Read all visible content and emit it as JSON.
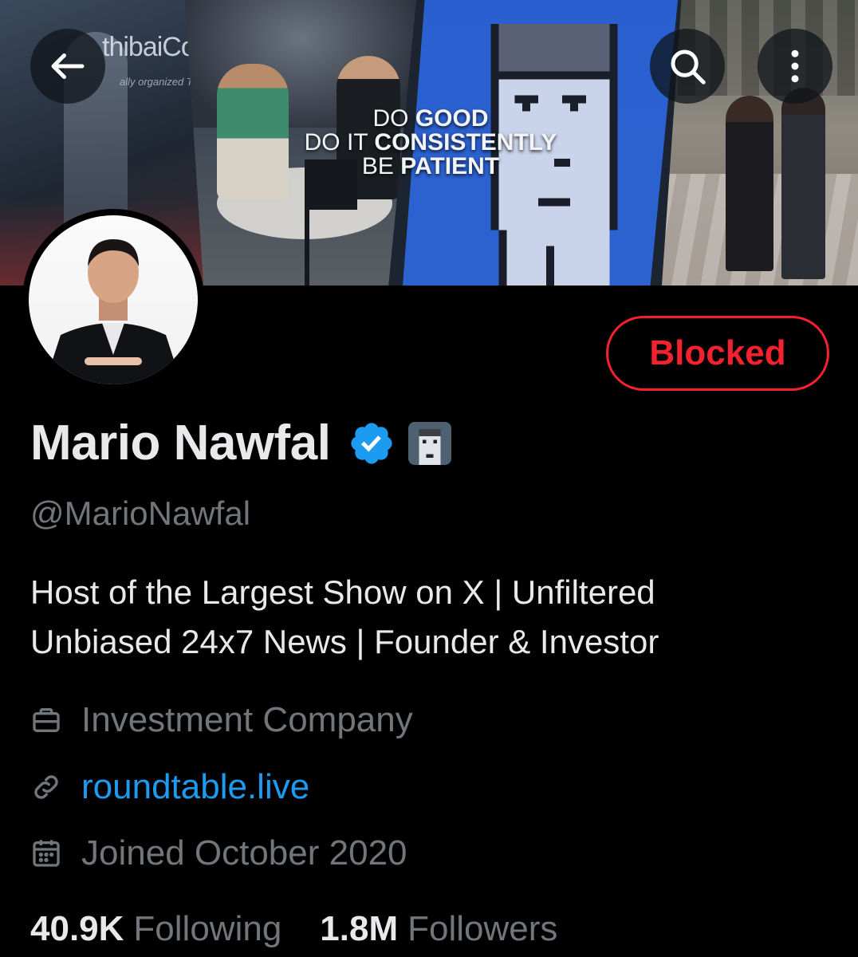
{
  "banner": {
    "sign_text": "thibaiColl",
    "sign_subtext": "ally organized TED e",
    "quote": {
      "line1_light": "DO",
      "line1_bold": "GOOD",
      "line2_light": "DO IT",
      "line2_bold": "CONSISTENTLY",
      "line3_light": "BE",
      "line3_bold": "PATIENT"
    }
  },
  "header": {
    "back_icon": "arrow-left-icon",
    "search_icon": "search-icon",
    "more_icon": "more-vertical-icon"
  },
  "profile": {
    "display_name": "Mario Nawfal",
    "handle": "@MarioNawfal",
    "bio_line1": "Host of the Largest Show on X | Unfiltered",
    "bio_line2": "Unbiased 24x7 News | Founder & Investor",
    "category": "Investment Company",
    "website": "roundtable.live",
    "joined": "Joined October 2020",
    "action_button": "Blocked"
  },
  "stats": {
    "following_count": "40.9K",
    "following_label": "Following",
    "followers_count": "1.8M",
    "followers_label": "Followers"
  },
  "colors": {
    "background": "#000000",
    "text_primary": "#e7e9ea",
    "text_secondary": "#71767b",
    "link": "#1d9bf0",
    "blocked": "#f4212e",
    "verified": "#1d9bf0"
  }
}
